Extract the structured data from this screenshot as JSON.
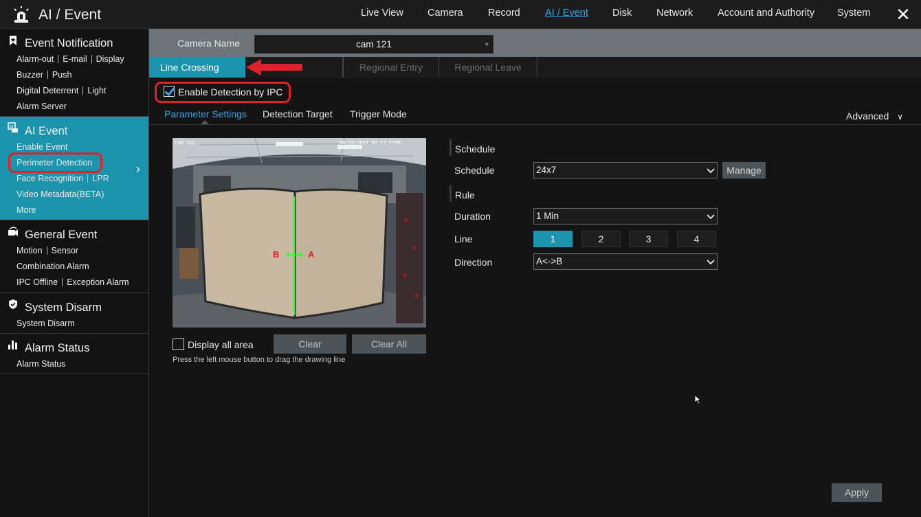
{
  "app": {
    "title": "AI / Event"
  },
  "nav": [
    {
      "label": "Live View"
    },
    {
      "label": "Camera"
    },
    {
      "label": "Record"
    },
    {
      "label": "AI / Event",
      "active": true
    },
    {
      "label": "Disk"
    },
    {
      "label": "Network"
    },
    {
      "label": "Account and Authority"
    },
    {
      "label": "System"
    }
  ],
  "sidebar": {
    "event_notification": {
      "title": "Event Notification",
      "row1": [
        "Alarm-out",
        "E-mail",
        "Display"
      ],
      "row2": [
        "Buzzer",
        "Push"
      ],
      "row3": [
        "Digital Deterrent",
        "Light"
      ],
      "row4": [
        "Alarm Server"
      ]
    },
    "ai_event": {
      "title": "AI Event",
      "row1": [
        "Enable Event"
      ],
      "row2": [
        "Perimeter Detection"
      ],
      "row3": [
        "Face Recognition",
        "LPR"
      ],
      "row4": [
        "Video Metadata(BETA)"
      ],
      "row5": [
        "More"
      ]
    },
    "general_event": {
      "title": "General Event",
      "row1": [
        "Motion",
        "Sensor"
      ],
      "row2": [
        "Combination Alarm"
      ],
      "row3": [
        "IPC Offline",
        "Exception Alarm"
      ]
    },
    "system_disarm": {
      "title": "System Disarm",
      "row1": [
        "System Disarm"
      ]
    },
    "alarm_status": {
      "title": "Alarm Status",
      "row1": [
        "Alarm Status"
      ]
    }
  },
  "camera": {
    "label": "Camera Name",
    "value": "cam 121"
  },
  "tabs": [
    "Line Crossing",
    "",
    "Regional Entry",
    "Regional Leave"
  ],
  "enable_ipc": {
    "label": "Enable Detection by IPC",
    "checked": true
  },
  "subtabs": [
    "Parameter Settings",
    "Detection Target",
    "Trigger Mode"
  ],
  "advanced": "Advanced",
  "preview": {
    "cam_name": "cam 121",
    "timestamp": "06/19/2024 09:23:47AM",
    "line_label_b": "B",
    "line_label_a": "A"
  },
  "display_all_area": {
    "label": "Display all area",
    "checked": false
  },
  "buttons": {
    "clear": "Clear",
    "clear_all": "Clear All",
    "manage": "Manage",
    "apply": "Apply"
  },
  "hint": "Press the left mouse button to drag the drawing line",
  "form": {
    "schedule_group": "Schedule",
    "schedule_label": "Schedule",
    "schedule_value": "24x7",
    "rule_group": "Rule",
    "duration_label": "Duration",
    "duration_value": "1 Min",
    "line_label": "Line",
    "lines": [
      "1",
      "2",
      "3",
      "4"
    ],
    "selected_line": "1",
    "direction_label": "Direction",
    "direction_value": "A<->B"
  },
  "colors": {
    "accent": "#1b93ad",
    "link_active": "#3ba3e0",
    "highlight": "#e0202a",
    "detection_line": "#22ff22"
  },
  "icons": [
    "alarm-light-icon",
    "close-icon",
    "bookmark-icon",
    "ai-event-icon",
    "general-event-icon",
    "shield-icon",
    "bar-chart-icon",
    "chevron-right-icon",
    "chevron-down-icon",
    "cursor-icon"
  ]
}
